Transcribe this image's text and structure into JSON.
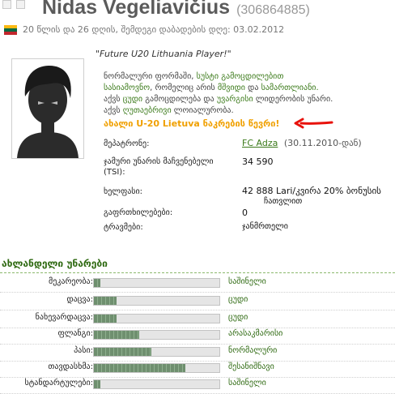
{
  "header": {
    "name": "Nidas Vegeliavičius",
    "id": "(306864885)",
    "subline": "20 წლის და 26 დღის, შემდეგი დაბადების დღე: 03.02.2012"
  },
  "flag_colors": [
    "#fdb913",
    "#006a44",
    "#c1272d"
  ],
  "profile": {
    "quote": "\"Future U20 Lithuania Player!\"",
    "desc_line1_a": "ნორმალური ფორმაში, ",
    "desc_line1_b": "სუსტი გამოცდილებით",
    "desc_line2_a": "სასიამოვნო",
    "desc_line2_b": ", რომელიც არის ",
    "desc_line2_c": "მშვიდი",
    "desc_line2_d": " და ",
    "desc_line2_e": "სამართლიანი.",
    "desc_line3_a": "აქვს ",
    "desc_line3_b": "ცუდი",
    "desc_line3_c": " გამოცდილება და ",
    "desc_line3_d": "უვარგისი",
    "desc_line3_e": " ლიდერობის უნარი.",
    "desc_line4_a": "აქვს ",
    "desc_line4_b": "ღუთაებრივი",
    "desc_line4_c": " ლოიალურობა.",
    "note": "ახალი U-20 Lietuva ნაკრების წევრი!"
  },
  "details": {
    "owner_label": "მეპატრონე:",
    "owner_value": "FC Adza",
    "owner_date": "(30.11.2010-დან)",
    "tsi_label_1": "ჯამური უნარის მაჩვენებელი",
    "tsi_label_2": "(TSI):",
    "tsi_value": "34 590",
    "wage_label": "ხელფასი:",
    "wage_value_1": "42 888 Lari/კვირა 20% ბონუსის",
    "wage_value_2": "ჩათვლით",
    "warnings_label": "გაფრთხილებები:",
    "warnings_value": "0",
    "injuries_label": "ტრავმები:",
    "injuries_value": "ჯანმრთელი"
  },
  "skills_title": "ახლანდელი უნარები",
  "skills": [
    {
      "name": "მეკარეობა:",
      "level": 0.05,
      "value": "საშინელი"
    },
    {
      "name": "დაცვა:",
      "level": 0.18,
      "value": "ცუდი"
    },
    {
      "name": "ნახევარდაცვა:",
      "level": 0.18,
      "value": "ცუდი"
    },
    {
      "name": "ფლანგი:",
      "level": 0.36,
      "value": "არასაკმარისი"
    },
    {
      "name": "პასი:",
      "level": 0.46,
      "value": "ნორმალური"
    },
    {
      "name": "თავდასხმა:",
      "level": 0.73,
      "value": "შესანიშნავი"
    },
    {
      "name": "სტანდარტულები:",
      "level": 0.05,
      "value": "საშინელი"
    }
  ]
}
